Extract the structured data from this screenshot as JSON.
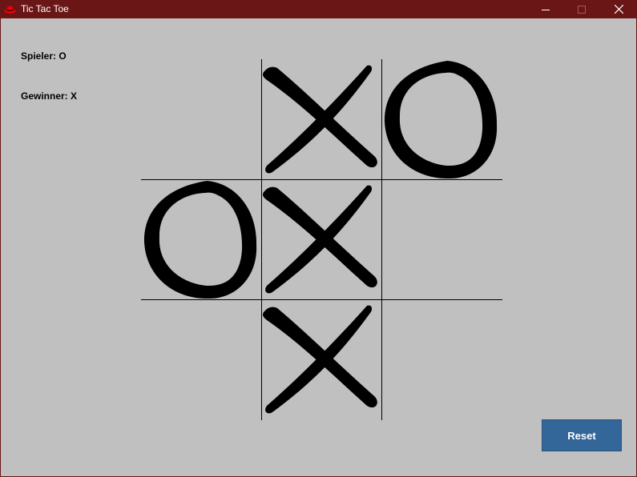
{
  "window": {
    "title": "Tic Tac Toe",
    "app_icon": "red-hat-icon",
    "controls": [
      "minimize-icon",
      "maximize-icon",
      "close-icon"
    ]
  },
  "status": {
    "player_label": "Spieler: O",
    "winner_label": "Gewinner: X"
  },
  "board": {
    "cells": [
      [
        "",
        "X",
        "O"
      ],
      [
        "O",
        "X",
        ""
      ],
      [
        "",
        "X",
        ""
      ]
    ]
  },
  "actions": {
    "reset_label": "Reset"
  },
  "colors": {
    "titlebar": "#6b1616",
    "background": "#c0c0c0",
    "button": "#336699",
    "mark": "#000000"
  }
}
